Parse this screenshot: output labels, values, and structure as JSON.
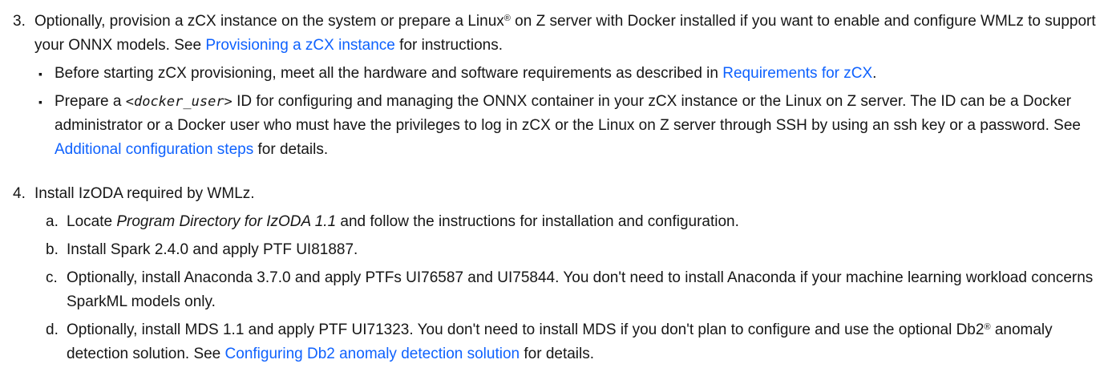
{
  "step3": {
    "number": "3.",
    "line_a": "Optionally, provision a zCX instance on the system or prepare a Linux",
    "reg": "®",
    "line_b": " on Z server with Docker installed if you want to enable and configure WMLz to support your ONNX models. See ",
    "link": "Provisioning a zCX instance",
    "line_c": " for instructions.",
    "bullets": [
      {
        "mark": "▪",
        "pre": "Before starting zCX provisioning, meet all the hardware and software requirements as described in ",
        "link": "Requirements for zCX",
        "post": "."
      },
      {
        "mark": "▪",
        "pre": "Prepare a ",
        "code": "<docker_user>",
        "mid": " ID for configuring and managing the ONNX container in your zCX instance or the Linux on Z server. The ID can be a Docker administrator or a Docker user who must have the privileges to log in zCX or the Linux on Z server through SSH by using an ssh key or a password. See ",
        "link": "Additional configuration steps",
        "post": " for details."
      }
    ]
  },
  "step4": {
    "number": "4.",
    "text": "Install IzODA required by WMLz.",
    "subs": [
      {
        "letter": "a.",
        "pre": "Locate ",
        "ital": "Program Directory for IzODA 1.1",
        "post": " and follow the instructions for installation and configuration."
      },
      {
        "letter": "b.",
        "text": "Install Spark 2.4.0 and apply PTF UI81887."
      },
      {
        "letter": "c.",
        "text": "Optionally, install Anaconda 3.7.0 and apply PTFs UI76587 and UI75844. You don't need to install Anaconda if your machine learning workload concerns SparkML models only."
      },
      {
        "letter": "d.",
        "pre": "Optionally, install MDS 1.1 and apply PTF UI71323. You don't need to install MDS if you don't plan to configure and use the optional Db2",
        "reg": "®",
        "mid": " anomaly detection solution. See ",
        "link": "Configuring Db2 anomaly detection solution",
        "post": " for details."
      }
    ]
  }
}
